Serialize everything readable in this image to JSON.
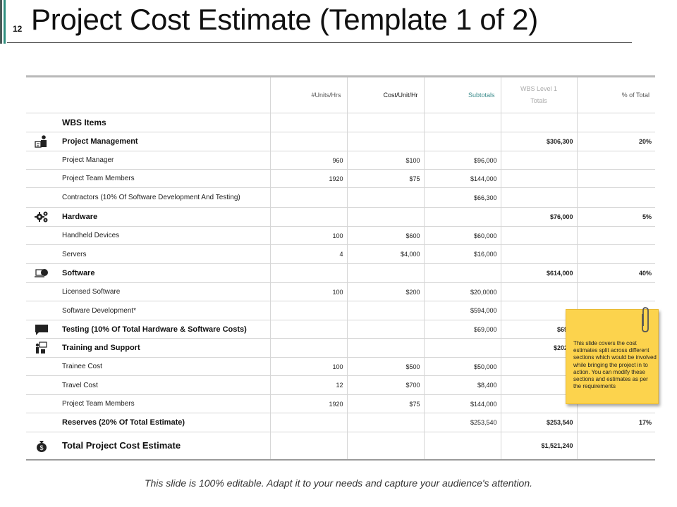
{
  "slide_number": "12",
  "title": "Project Cost Estimate (Template 1 of 2)",
  "headers": {
    "units": "#Units/Hrs",
    "cost": "Cost/Unit/Hr",
    "subtotals": "Subtotals",
    "wbs_line1": "WBS Level 1",
    "wbs_line2": "Totals",
    "pct": "% of Total"
  },
  "wbs_items_label": "WBS Items",
  "rows": [
    {
      "label": "Project Management",
      "units": "",
      "cost": "",
      "subtotal": "",
      "wbs": "$306,300",
      "pct": "20%",
      "icon": "people-icon"
    },
    {
      "label": "Project Manager",
      "units": "960",
      "cost": "$100",
      "subtotal": "$96,000",
      "wbs": "",
      "pct": ""
    },
    {
      "label": "Project Team Members",
      "units": "1920",
      "cost": "$75",
      "subtotal": "$144,000",
      "wbs": "",
      "pct": ""
    },
    {
      "label": "Contractors (10% Of Software Development And Testing)",
      "units": "",
      "cost": "",
      "subtotal": "$66,300",
      "wbs": "",
      "pct": ""
    },
    {
      "label": "Hardware",
      "units": "",
      "cost": "",
      "subtotal": "",
      "wbs": "$76,000",
      "pct": "5%",
      "icon": "gears-icon"
    },
    {
      "label": "Handheld Devices",
      "units": "100",
      "cost": "$600",
      "subtotal": "$60,000",
      "wbs": "",
      "pct": ""
    },
    {
      "label": "Servers",
      "units": "4",
      "cost": "$4,000",
      "subtotal": "$16,000",
      "wbs": "",
      "pct": ""
    },
    {
      "label": "Software",
      "units": "",
      "cost": "",
      "subtotal": "",
      "wbs": "$614,000",
      "pct": "40%",
      "icon": "laptop-icon"
    },
    {
      "label": "Licensed Software",
      "units": "100",
      "cost": "$200",
      "subtotal": "$20,0000",
      "wbs": "",
      "pct": ""
    },
    {
      "label": "Software Development*",
      "units": "",
      "cost": "",
      "subtotal": "$594,000",
      "wbs": "",
      "pct": ""
    },
    {
      "label": "Testing (10% Of Total Hardware & Software Costs)",
      "units": "",
      "cost": "",
      "subtotal": "$69,000",
      "wbs": "$69,0",
      "pct": "",
      "icon": "chat-icon"
    },
    {
      "label": "Training and Support",
      "units": "",
      "cost": "",
      "subtotal": "",
      "wbs": "$202,4",
      "pct": "",
      "icon": "presenter-icon"
    },
    {
      "label": "Trainee Cost",
      "units": "100",
      "cost": "$500",
      "subtotal": "$50,000",
      "wbs": "",
      "pct": ""
    },
    {
      "label": "Travel Cost",
      "units": "12",
      "cost": "$700",
      "subtotal": "$8,400",
      "wbs": "",
      "pct": ""
    },
    {
      "label": "Project Team Members",
      "units": "1920",
      "cost": "$75",
      "subtotal": "$144,000",
      "wbs": "",
      "pct": ""
    },
    {
      "label": "Reserves (20% Of Total Estimate)",
      "units": "",
      "cost": "",
      "subtotal": "$253,540",
      "wbs": "$253,540",
      "pct": "17%"
    },
    {
      "label": "Total Project Cost Estimate",
      "units": "",
      "cost": "",
      "subtotal": "",
      "wbs": "$1,521,240",
      "pct": "",
      "icon": "money-bag-icon"
    }
  ],
  "note": "This slide covers the cost estimates split across different sections which would be involved while bringing the project in to action. You can modify these sections and estimates as per the requirements",
  "footer": "This slide is 100% editable. Adapt it to your needs and capture your audience's attention."
}
